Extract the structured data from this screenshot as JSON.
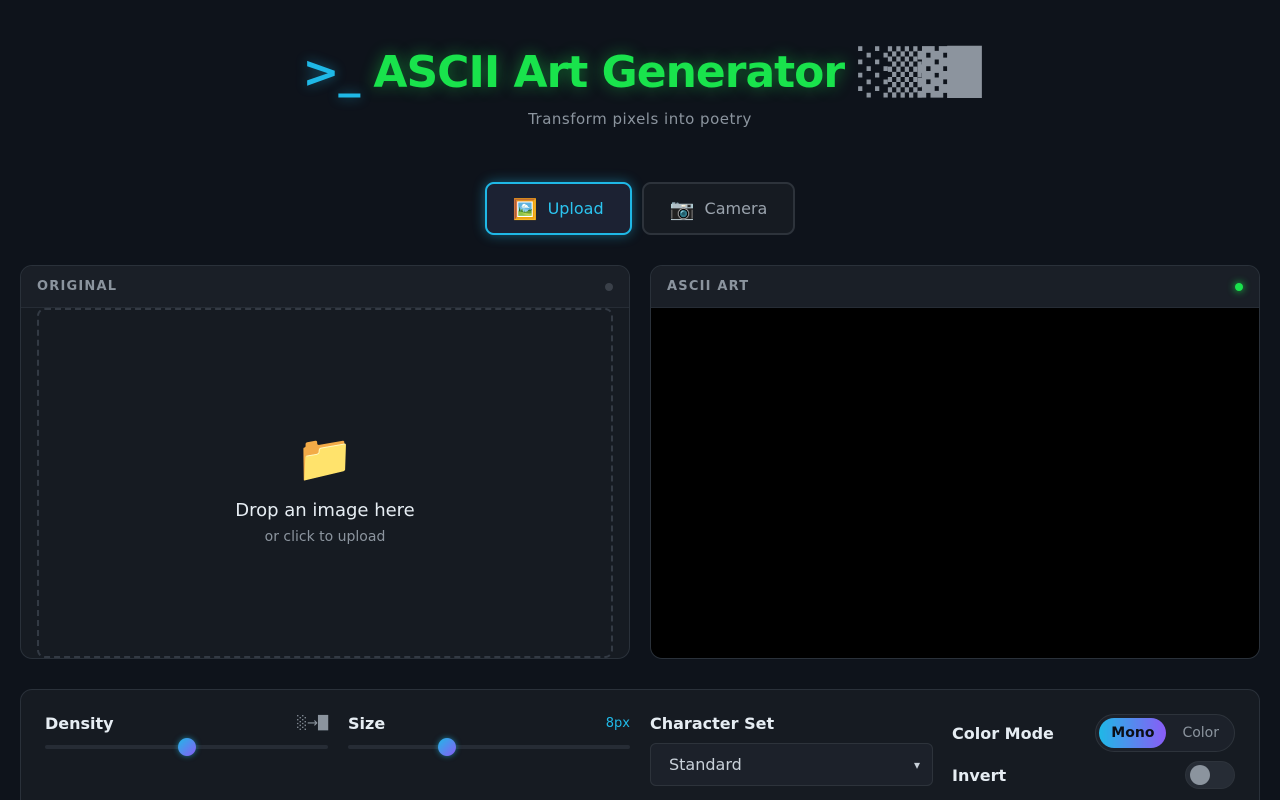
{
  "header": {
    "prompt": ">_",
    "title": "ASCII Art Generator",
    "blocks": "░▒▓█",
    "subtitle": "Transform pixels into poetry"
  },
  "modes": [
    {
      "label": "Upload",
      "icon": "framed-picture-icon",
      "emoji": "🖼️",
      "active": true
    },
    {
      "label": "Camera",
      "icon": "camera-icon",
      "emoji": "📷",
      "active": false
    }
  ],
  "panels": {
    "original": {
      "title": "ORIGINAL",
      "status": "idle"
    },
    "ascii": {
      "title": "ASCII ART",
      "status": "live"
    }
  },
  "dropzone": {
    "icon": "folder-icon",
    "emoji": "📁",
    "main": "Drop an image here",
    "sub": "or click to upload"
  },
  "controls": {
    "density": {
      "label": "Density",
      "hint": "░→█",
      "value": 0.5
    },
    "size": {
      "label": "Size",
      "value_text": "8px",
      "value": 0.35
    },
    "charset": {
      "label": "Character Set",
      "selected": "Standard"
    },
    "color_mode": {
      "label": "Color Mode",
      "options": [
        "Mono",
        "Color"
      ],
      "selected": "Mono"
    },
    "invert": {
      "label": "Invert",
      "on": false
    }
  },
  "colors": {
    "accent": "#1fb8e6",
    "title_green": "#19e34c",
    "background": "#0e131b"
  }
}
